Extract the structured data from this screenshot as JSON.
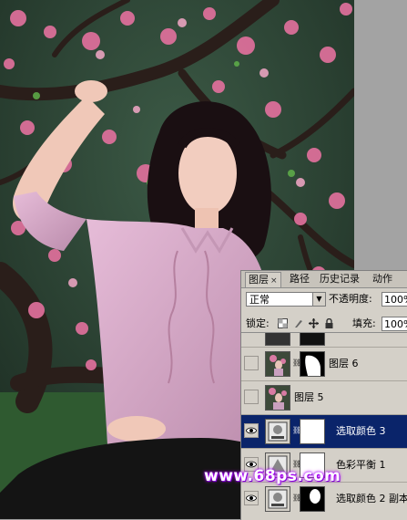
{
  "panel": {
    "tabs": [
      {
        "label": "图层",
        "close": "×"
      },
      {
        "label": "路径"
      },
      {
        "label": "历史记录"
      },
      {
        "label": "动作"
      }
    ],
    "blend_mode": "正常",
    "opacity_label": "不透明度:",
    "opacity_value": "100%",
    "lock_label": "锁定:",
    "fill_label": "填充:",
    "fill_value": "100%"
  },
  "layers": [
    {
      "name": "图层 6",
      "visible": false
    },
    {
      "name": "图层 5",
      "visible": false
    },
    {
      "name": "选取颜色 3",
      "visible": true,
      "selected": true
    },
    {
      "name": "色彩平衡 1",
      "visible": true
    },
    {
      "name": "选取颜色 2 副本",
      "visible": true
    }
  ],
  "watermark": "www.68ps.com",
  "colors": {
    "selection": "#0a246a",
    "panel_bg": "#d4d0c8",
    "blossom": "#e0709c",
    "shirt": "#d8a8c8"
  },
  "icons": [
    "eye-icon",
    "chain-link-icon",
    "lock-transparent-icon",
    "lock-brush-icon",
    "lock-move-icon",
    "lock-all-icon"
  ]
}
